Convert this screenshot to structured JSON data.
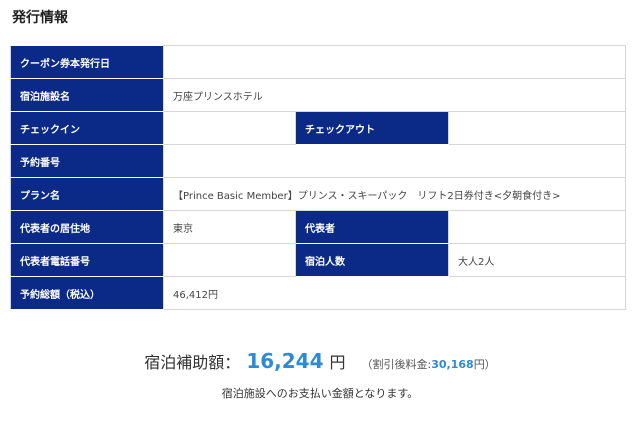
{
  "section": {
    "title": "発行情報"
  },
  "table": {
    "coupon_date_label": "クーポン券本発行日",
    "coupon_date_value": "",
    "facility_label": "宿泊施設名",
    "facility_value": "万座プリンスホテル",
    "checkin_label": "チェックイン",
    "checkin_value": "",
    "checkout_label": "チェックアウト",
    "checkout_value": "",
    "reservation_label": "予約番号",
    "reservation_value": "",
    "plan_label": "プラン名",
    "plan_value": "【Prince Basic Member】プリンス・スキーパック　リフト2日券付き<夕朝食付き>",
    "rep_address_label": "代表者の居住地",
    "rep_address_value": "東京",
    "rep_label": "代表者",
    "rep_value": "",
    "rep_phone_label": "代表者電話番号",
    "rep_phone_value": "",
    "guests_label": "宿泊人数",
    "guests_value": "大人2人",
    "total_label": "予約総額（税込）",
    "total_value": "46,412円"
  },
  "subsidy": {
    "label": "宿泊補助額：",
    "amount": "16,244",
    "unit": "円",
    "discount_prefix": "（割引後料金:",
    "discount_value": "30,168",
    "discount_suffix": "円）",
    "note": "宿泊施設へのお支払い金額となります。"
  },
  "colors": {
    "header_bg": "#0b2a87",
    "accent": "#2e8ad2"
  }
}
